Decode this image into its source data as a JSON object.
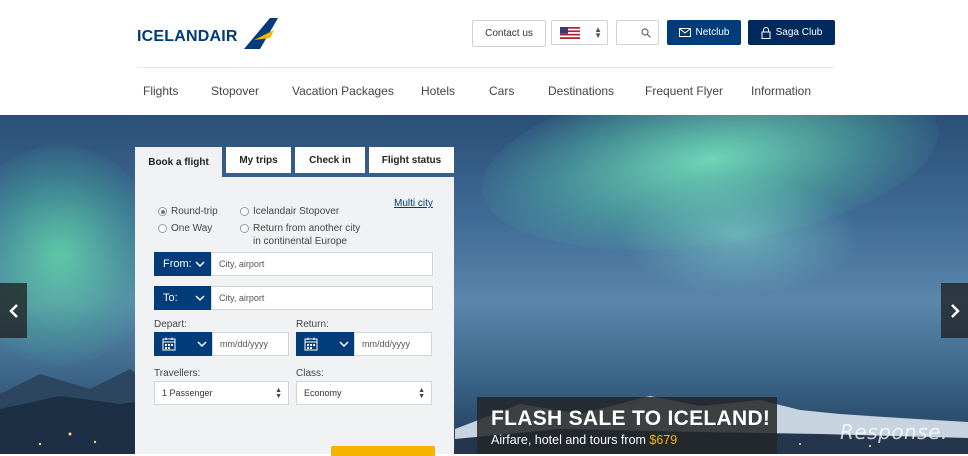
{
  "brand": {
    "name": "ICELANDAIR",
    "color": "#003b7a",
    "accent": "#f4b400"
  },
  "header": {
    "contact_label": "Contact us",
    "country_icon": "us-flag-icon",
    "search_icon": "search-icon",
    "netclub_label": "Netclub",
    "saga_label": "Saga Club"
  },
  "nav": [
    "Flights",
    "Stopover",
    "Vacation Packages",
    "Hotels",
    "Cars",
    "Destinations",
    "Frequent Flyer",
    "Information"
  ],
  "booking": {
    "tabs": [
      "Book a flight",
      "My trips",
      "Check in",
      "Flight status"
    ],
    "active_tab": "Book a flight",
    "trip_types": {
      "round_trip": "Round-trip",
      "one_way": "One Way",
      "stopover": "Icelandair Stopover",
      "return_other_1": "Return from another city",
      "return_other_2": "in continental Europe",
      "selected": "Round-trip"
    },
    "multi_city": "Multi city",
    "from_label": "From:",
    "from_placeholder": "City, airport",
    "to_label": "To:",
    "to_placeholder": "City, airport",
    "depart_label": "Depart:",
    "depart_placeholder": "mm/dd/yyyy",
    "return_label": "Return:",
    "return_placeholder": "mm/dd/yyyy",
    "travellers_label": "Travellers:",
    "travellers_value": "1 Passenger",
    "class_label": "Class:",
    "class_value": "Economy"
  },
  "promo": {
    "title": "FLASH SALE TO ICELAND!",
    "subtitle": "Airfare, hotel and tours from ",
    "price": "$679"
  },
  "watermark": "Response."
}
